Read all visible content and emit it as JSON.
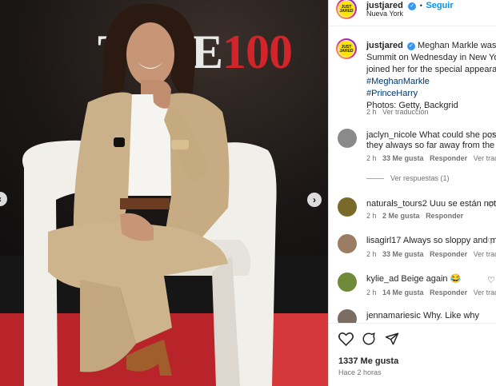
{
  "post": {
    "image_alt": "Meghan Markle seated on stage at TIME100 summit in a beige suit",
    "brand_letters_white": "TIME",
    "brand_letters_red": "100"
  },
  "header": {
    "username": "justjared",
    "follow_label": "Seguir",
    "location": "Nueva York",
    "separator": "•",
    "avatar_text_top": "JUST",
    "avatar_text_bottom": "JARED"
  },
  "caption": {
    "username": "justjared",
    "line1": "Meghan Markle was a gu",
    "line2": "Summit on Wednesday in New York",
    "line3": "joined her for the special appearance",
    "hashtag1": "#MeghanMarkle",
    "hashtag2": "#PrinceHarry",
    "line6": "Photos: Getty, Backgrid",
    "time": "2 h",
    "translate": "Ver traducción"
  },
  "comments": [
    {
      "user": "jaclyn_nicole",
      "text": "What could she possib",
      "text2": "they always so far away from the kid",
      "time": "2 h",
      "likes": "33 Me gusta",
      "reply": "Responder",
      "translate": "Ver trad",
      "replies": "Ver respuestas (1)",
      "avatar_color": "#8a8a8a"
    },
    {
      "user": "naturals_tours2",
      "text": "Uuu se están notand",
      "time": "2 h",
      "likes": "2 Me gusta",
      "reply": "Responder",
      "avatar_color": "#7a6a2a"
    },
    {
      "user": "lisagirl17",
      "text": "Always so sloppy and mess",
      "time": "2 h",
      "likes": "33 Me gusta",
      "reply": "Responder",
      "translate": "Ver trad",
      "avatar_color": "#9a7d62"
    },
    {
      "user": "kylie_ad",
      "text": "Beige again 😂",
      "time": "2 h",
      "likes": "14 Me gusta",
      "reply": "Responder",
      "translate": "Ver trad",
      "avatar_color": "#6f8a3a"
    },
    {
      "user": "jennamariesic",
      "text": "Why. Like why",
      "avatar_color": "#7b6d63"
    }
  ],
  "footer": {
    "likes": "1337 Me gusta",
    "time": "Hace 2 horas"
  },
  "colors": {
    "accent": "#0095f6",
    "stage_red": "#b8242a",
    "suit": "#cbb189"
  },
  "icons": [
    "heart-icon",
    "comment-icon",
    "share-icon",
    "chevron-left-icon",
    "chevron-right-icon",
    "verified-icon"
  ]
}
